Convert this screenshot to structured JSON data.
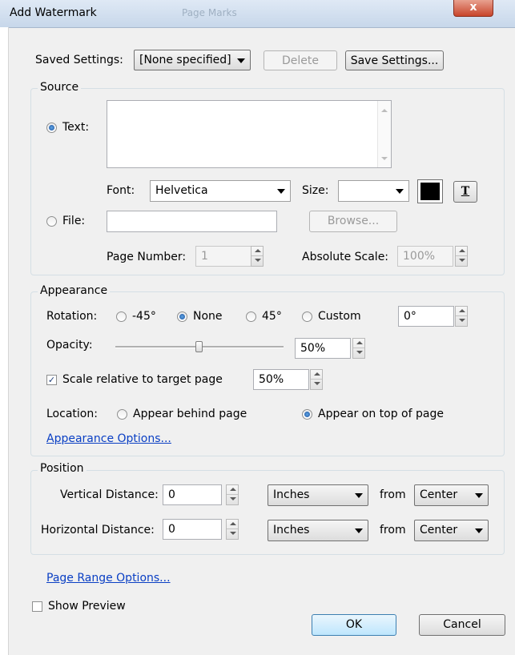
{
  "window": {
    "title": "Add Watermark",
    "ghost_title": "Page Marks",
    "close_glyph": "x"
  },
  "saved_settings": {
    "label": "Saved Settings:",
    "value": "[None specified]",
    "delete_label": "Delete",
    "save_label": "Save Settings..."
  },
  "source": {
    "legend": "Source",
    "text_option": "Text:",
    "text_value": "",
    "font_label": "Font:",
    "font_value": "Helvetica",
    "size_label": "Size:",
    "size_value": "",
    "color_value": "#000000",
    "text_format_icon": "text-format-icon",
    "file_option": "File:",
    "file_value": "",
    "browse_label": "Browse...",
    "page_number_label": "Page Number:",
    "page_number_value": "1",
    "absolute_scale_label": "Absolute Scale:",
    "absolute_scale_value": "100%"
  },
  "appearance": {
    "legend": "Appearance",
    "rotation_label": "Rotation:",
    "rotation_options": [
      "-45°",
      "None",
      "45°",
      "Custom"
    ],
    "rotation_selected": "None",
    "custom_rotation_value": "0°",
    "opacity_label": "Opacity:",
    "opacity_value": "50%",
    "opacity_level": 0.5,
    "scale_relative_label": "Scale relative to target page",
    "scale_relative_checked": true,
    "scale_value": "50%",
    "location_label": "Location:",
    "location_behind": "Appear behind page",
    "location_top": "Appear on top of page",
    "location_selected": "Appear on top of page",
    "options_link": "Appearance Options..."
  },
  "position": {
    "legend": "Position",
    "vertical_label": "Vertical Distance:",
    "vertical_value": "0",
    "vertical_unit": "Inches",
    "vertical_from_label": "from",
    "vertical_from": "Center",
    "horizontal_label": "Horizontal Distance:",
    "horizontal_value": "0",
    "horizontal_unit": "Inches",
    "horizontal_from_label": "from",
    "horizontal_from": "Center"
  },
  "page_range_link": "Page Range Options...",
  "show_preview_label": "Show Preview",
  "show_preview_checked": false,
  "ok_label": "OK",
  "cancel_label": "Cancel"
}
